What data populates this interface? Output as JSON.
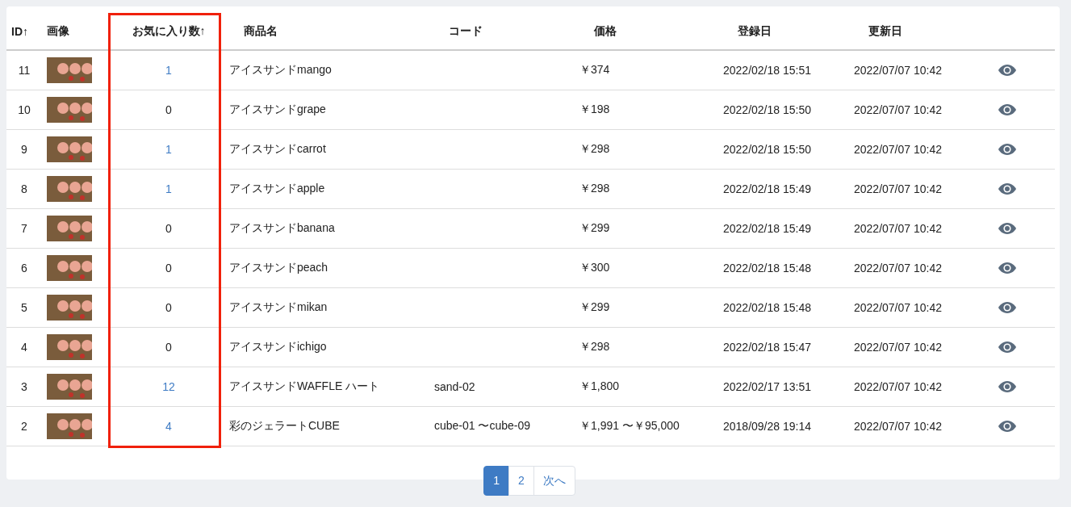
{
  "table": {
    "columns": [
      {
        "label": "ID↑",
        "highlighted": false
      },
      {
        "label": "画像",
        "highlighted": false
      },
      {
        "label": "お気に入り数↑",
        "highlighted": true
      },
      {
        "label": "商品名",
        "highlighted": false
      },
      {
        "label": "コード",
        "highlighted": false
      },
      {
        "label": "価格",
        "highlighted": false
      },
      {
        "label": "登録日",
        "highlighted": false
      },
      {
        "label": "更新日",
        "highlighted": false
      }
    ],
    "rows": [
      {
        "id": "11",
        "favorites": "1",
        "favorites_linked": true,
        "name": "アイスサンドmango",
        "code": "",
        "price": "￥374",
        "created": "2022/02/18 15:51",
        "updated": "2022/07/07 10:42"
      },
      {
        "id": "10",
        "favorites": "0",
        "favorites_linked": false,
        "name": "アイスサンドgrape",
        "code": "",
        "price": "￥198",
        "created": "2022/02/18 15:50",
        "updated": "2022/07/07 10:42"
      },
      {
        "id": "9",
        "favorites": "1",
        "favorites_linked": true,
        "name": "アイスサンドcarrot",
        "code": "",
        "price": "￥298",
        "created": "2022/02/18 15:50",
        "updated": "2022/07/07 10:42"
      },
      {
        "id": "8",
        "favorites": "1",
        "favorites_linked": true,
        "name": "アイスサンドapple",
        "code": "",
        "price": "￥298",
        "created": "2022/02/18 15:49",
        "updated": "2022/07/07 10:42"
      },
      {
        "id": "7",
        "favorites": "0",
        "favorites_linked": false,
        "name": "アイスサンドbanana",
        "code": "",
        "price": "￥299",
        "created": "2022/02/18 15:49",
        "updated": "2022/07/07 10:42"
      },
      {
        "id": "6",
        "favorites": "0",
        "favorites_linked": false,
        "name": "アイスサンドpeach",
        "code": "",
        "price": "￥300",
        "created": "2022/02/18 15:48",
        "updated": "2022/07/07 10:42"
      },
      {
        "id": "5",
        "favorites": "0",
        "favorites_linked": false,
        "name": "アイスサンドmikan",
        "code": "",
        "price": "￥299",
        "created": "2022/02/18 15:48",
        "updated": "2022/07/07 10:42"
      },
      {
        "id": "4",
        "favorites": "0",
        "favorites_linked": false,
        "name": "アイスサンドichigo",
        "code": "",
        "price": "￥298",
        "created": "2022/02/18 15:47",
        "updated": "2022/07/07 10:42"
      },
      {
        "id": "3",
        "favorites": "12",
        "favorites_linked": true,
        "name": "アイスサンドWAFFLE ハート",
        "code": "sand-02",
        "price": "￥1,800",
        "created": "2022/02/17 13:51",
        "updated": "2022/07/07 10:42"
      },
      {
        "id": "2",
        "favorites": "4",
        "favorites_linked": true,
        "name": "彩のジェラートCUBE",
        "code": "cube-01 〜cube-09",
        "price": "￥1,991 〜￥95,000",
        "created": "2018/09/28 19:14",
        "updated": "2022/07/07 10:42"
      }
    ]
  },
  "pagination": [
    {
      "label": "1",
      "selected": true
    },
    {
      "label": "2",
      "selected": false
    },
    {
      "label": "次へ",
      "selected": false
    }
  ]
}
